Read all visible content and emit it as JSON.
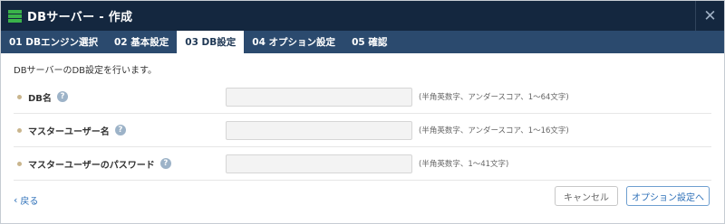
{
  "window": {
    "title": "DBサーバー - 作成",
    "icon": "server-stack-icon",
    "close_label": "✕"
  },
  "tabs": [
    {
      "label": "01 DBエンジン選択",
      "active": false
    },
    {
      "label": "02 基本設定",
      "active": false
    },
    {
      "label": "03 DB設定",
      "active": true
    },
    {
      "label": "04 オプション設定",
      "active": false
    },
    {
      "label": "05 確認",
      "active": false
    }
  ],
  "description": "DBサーバーのDB設定を行います。",
  "fields": [
    {
      "label": "DB名",
      "value": "",
      "hint": "(半角英数字、アンダースコア、1～64文字)"
    },
    {
      "label": "マスターユーザー名",
      "value": "",
      "hint": "(半角英数字、アンダースコア、1～16文字)"
    },
    {
      "label": "マスターユーザーのパスワード",
      "value": "",
      "hint": "(半角英数字、1～41文字)"
    }
  ],
  "help_glyph": "?",
  "footer": {
    "back_label": "戻る",
    "cancel_label": "キャンセル",
    "next_label": "オプション設定へ"
  },
  "colors": {
    "titlebar": "#14273f",
    "tabbar": "#2b4a6e",
    "accent_green": "#3ab34a",
    "link_blue": "#2c6fb8",
    "bullet": "#c9b58d"
  }
}
